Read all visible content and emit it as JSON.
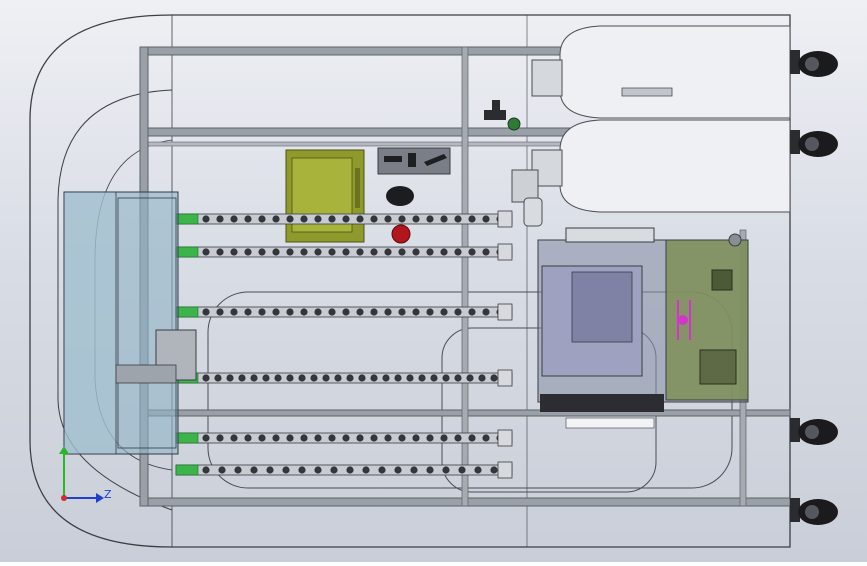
{
  "view": {
    "triad_axes": {
      "z": "Z"
    },
    "colors": {
      "background_top": "#eef0f4",
      "background_bottom": "#c9ced8",
      "frame": "#5e6268",
      "frame_light": "#9aa0a8",
      "shell_outline": "#3c3f44",
      "cylinder_body": "#f0f2f4",
      "control_panel": "#8f9a2c",
      "tube_green": "#3bb54a",
      "triad_z": "#1f3fd1",
      "triad_y": "#2bb52b",
      "triad_x": "#d12b2b",
      "indicator_red": "#b0161c",
      "wheel": "#1b1b1e",
      "pcb": "#7e8f57",
      "magenta": "#d236c8"
    }
  }
}
